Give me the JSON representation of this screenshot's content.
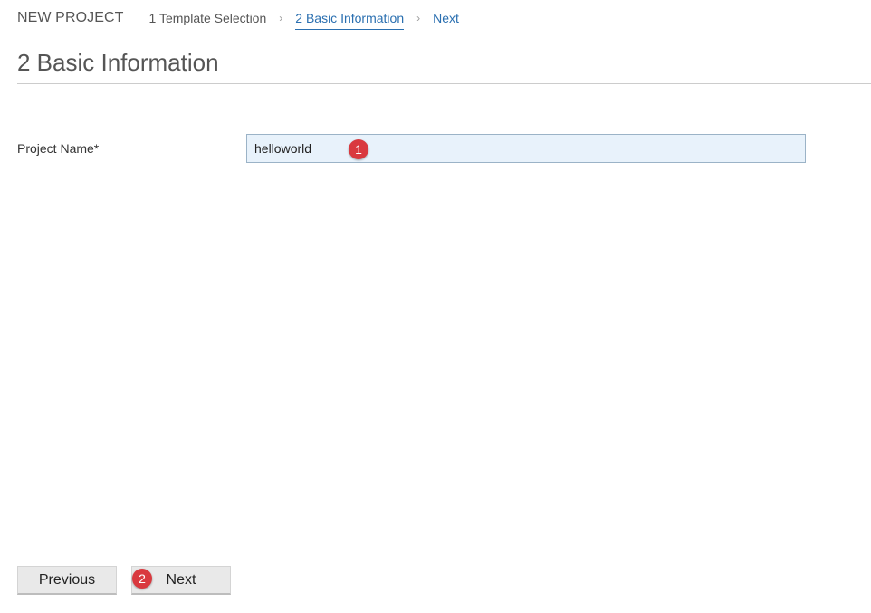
{
  "header": {
    "app_title": "NEW PROJECT",
    "breadcrumb": {
      "step1": "1 Template Selection",
      "step2": "2 Basic Information",
      "step3": "Next",
      "separator": "›"
    }
  },
  "page": {
    "title": "2 Basic Information"
  },
  "form": {
    "project_name_label": "Project Name*",
    "project_name_value": "helloworld"
  },
  "annotations": {
    "marker1": "1",
    "marker2": "2"
  },
  "footer": {
    "previous_label": "Previous",
    "next_label": "Next"
  },
  "colors": {
    "accent": "#2a6fb0",
    "marker": "#d9393f",
    "input_bg": "#e8f2fb"
  }
}
